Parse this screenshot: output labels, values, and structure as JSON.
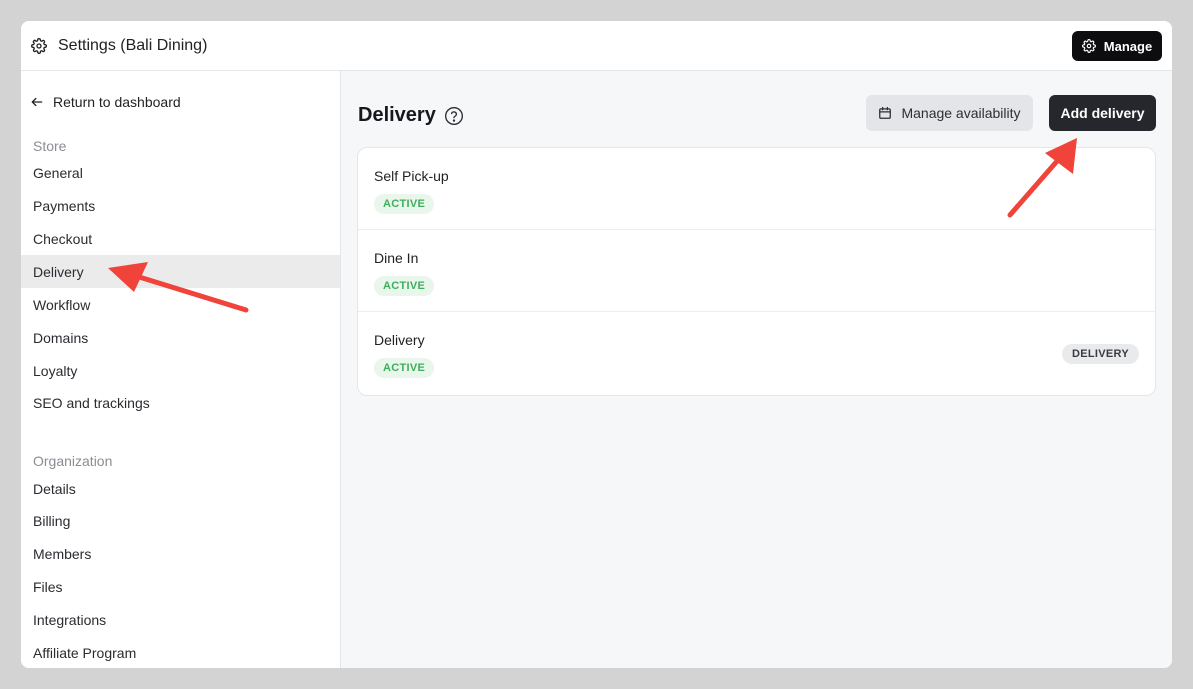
{
  "window": {
    "title": "Settings (Bali Dining)",
    "manage_label": "Manage"
  },
  "sidebar": {
    "back_label": "Return to dashboard",
    "store_label": "Store",
    "store_items": [
      {
        "label": "General",
        "active": false
      },
      {
        "label": "Payments",
        "active": false
      },
      {
        "label": "Checkout",
        "active": false
      },
      {
        "label": "Delivery",
        "active": true
      },
      {
        "label": "Workflow",
        "active": false
      },
      {
        "label": "Domains",
        "active": false
      },
      {
        "label": "Loyalty",
        "active": false
      },
      {
        "label": "SEO and trackings",
        "active": false
      }
    ],
    "org_label": "Organization",
    "org_items": [
      {
        "label": "Details"
      },
      {
        "label": "Billing"
      },
      {
        "label": "Members"
      },
      {
        "label": "Files"
      },
      {
        "label": "Integrations"
      },
      {
        "label": "Affiliate Program"
      }
    ]
  },
  "main": {
    "title": "Delivery",
    "availability_label": "Manage availability",
    "add_label": "Add delivery",
    "methods": [
      {
        "name": "Self Pick-up",
        "status": "ACTIVE",
        "type": ""
      },
      {
        "name": "Dine In",
        "status": "ACTIVE",
        "type": ""
      },
      {
        "name": "Delivery",
        "status": "ACTIVE",
        "type": "DELIVERY"
      }
    ]
  },
  "colors": {
    "annotation_arrow": "#f0433a",
    "active_status_text": "#3fae5c",
    "active_status_bg": "#e8f6ec",
    "primary_button": "#25272c"
  }
}
